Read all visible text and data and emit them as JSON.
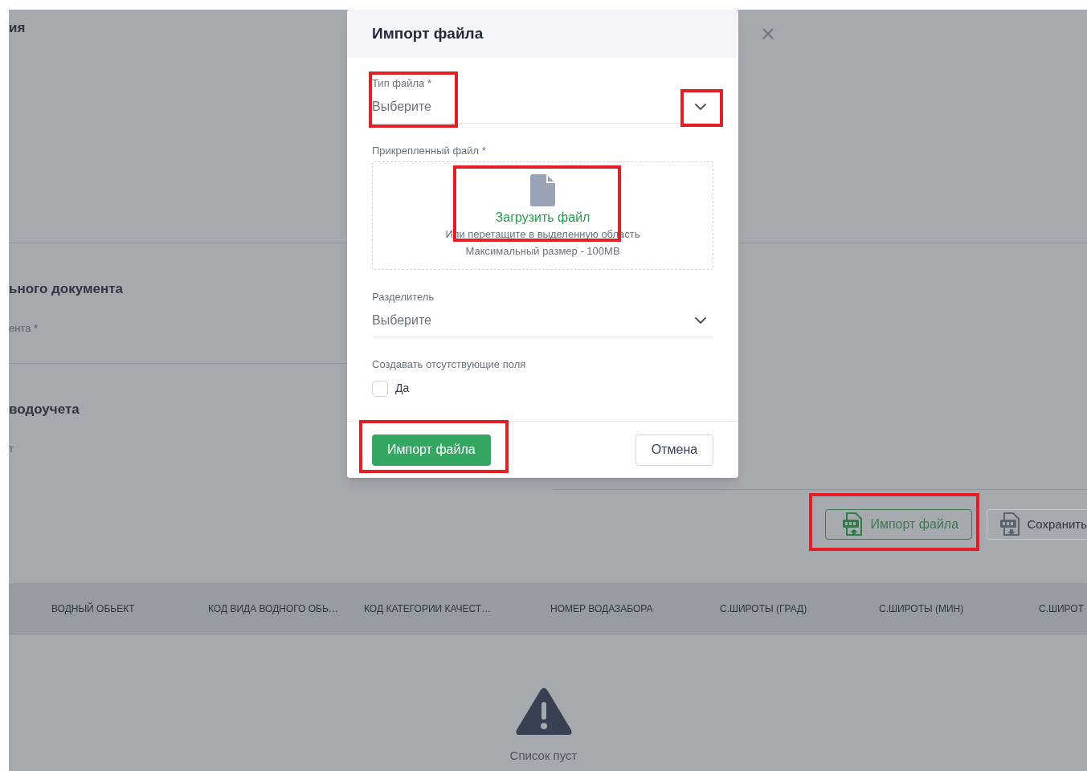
{
  "background": {
    "title": "ия",
    "sections": [
      {
        "heading": "ьного документа",
        "label": "ента *"
      },
      {
        "heading": "водоучета",
        "label": "т"
      }
    ],
    "actions": [
      {
        "kind": "import",
        "label": "Импорт файла"
      },
      {
        "kind": "save",
        "label": "Сохранить"
      }
    ],
    "table": {
      "columns": [
        "ВОДНЫЙ ОБЬЕКТ",
        "КОД ВИДА ВОДНОГО ОБЬ…",
        "КОД КАТЕГОРИИ КАЧЕСТ…",
        "НОМЕР ВОДАЗАБОРА",
        "С.ШИРОТЫ (ГРАД)",
        "С.ШИРОТЫ (МИН)",
        "С.ШИРОТ"
      ]
    },
    "empty_state": {
      "text": "Список пуст"
    }
  },
  "dialog": {
    "title": "Импорт файла",
    "file_type": {
      "label": "Тип файла *",
      "placeholder": "Выберите"
    },
    "attachment": {
      "label": "Прикрепленный файл *",
      "upload_link": "Загрузить файл",
      "hint": "Или перетащите в выделенную область",
      "max_size": "Максимальный размер - 100MB"
    },
    "separator": {
      "label": "Разделитель",
      "placeholder": "Выберите"
    },
    "create_missing": {
      "label": "Создавать отсутствующие поля",
      "option": "Да",
      "checked": false
    },
    "buttons": [
      {
        "kind": "primary",
        "label": "Импорт файла"
      },
      {
        "kind": "secondary",
        "label": "Отмена"
      }
    ]
  }
}
